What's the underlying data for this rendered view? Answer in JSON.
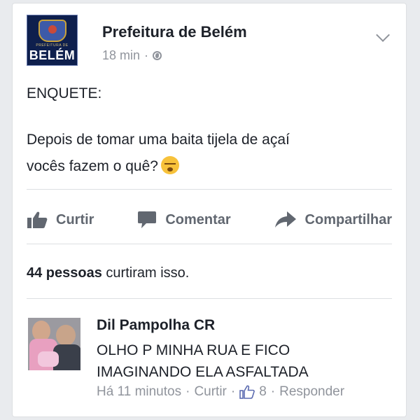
{
  "post": {
    "page_name": "Prefeitura de Belém",
    "time": "18 min",
    "separator": "·",
    "logo_text": "BELÉM",
    "logo_small_text": "PREFEITURA DE",
    "line1": "ENQUETE:",
    "line2": "Depois de tomar uma baita tijela de açaí",
    "line3": "vocês fazem o quê?",
    "emoji_name": "sleeping-face"
  },
  "actions": {
    "like_label": "Curtir",
    "comment_label": "Comentar",
    "share_label": "Compartilhar"
  },
  "likes": {
    "count_text": "44 pessoas",
    "suffix": "curtiram isso."
  },
  "comment": {
    "author": "Dil Pampolha CR",
    "line1": "OLHO P MINHA RUA E FICO",
    "line2": "IMAGINANDO ELA ASFALTADA",
    "time": "Há 11 minutos",
    "sep": "·",
    "like_label": "Curtir",
    "like_count": "8",
    "reply_label": "Responder"
  },
  "colors": {
    "primary_text": "#1d2129",
    "secondary_text": "#90949c",
    "action_text": "#616770",
    "background": "#e9ebee"
  }
}
